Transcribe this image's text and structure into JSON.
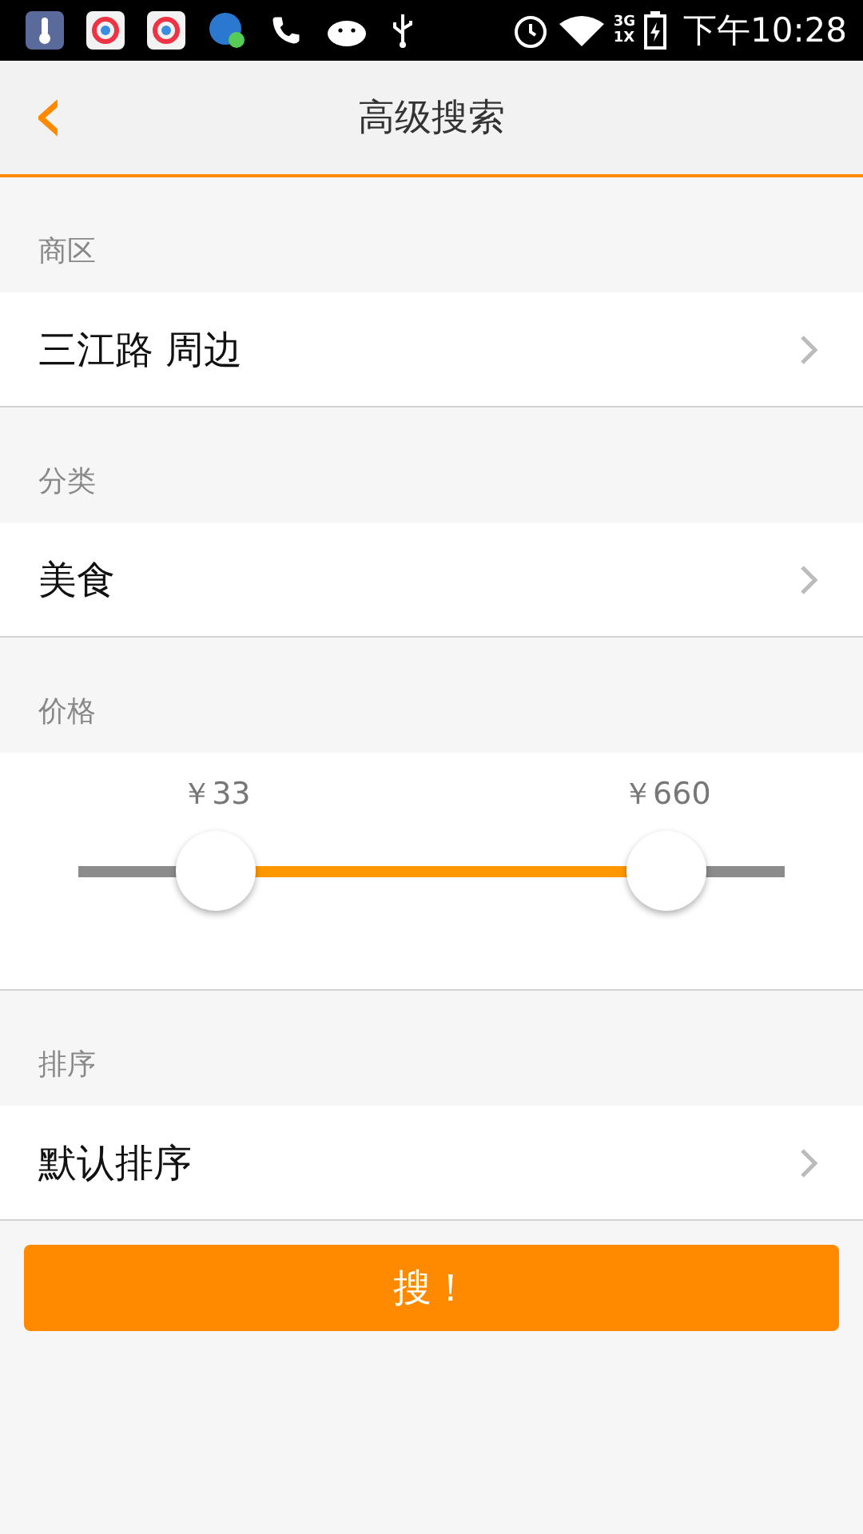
{
  "status_bar": {
    "network_top": "3G",
    "network_bottom": "1X",
    "time": "下午10:28"
  },
  "header": {
    "back": "‹",
    "title": "高级搜索"
  },
  "sections": [
    {
      "label": "商区",
      "kind": "select",
      "value": "三江路 周边"
    },
    {
      "label": "分类",
      "kind": "select",
      "value": "美食"
    },
    {
      "label": "价格",
      "kind": "range",
      "thumbs": [
        {
          "reading": "￥33",
          "level": 0.195
        },
        {
          "reading": "￥660",
          "level": 0.833
        }
      ]
    },
    {
      "label": "排序",
      "kind": "select",
      "value": "默认排序"
    }
  ],
  "search_button": "搜！"
}
